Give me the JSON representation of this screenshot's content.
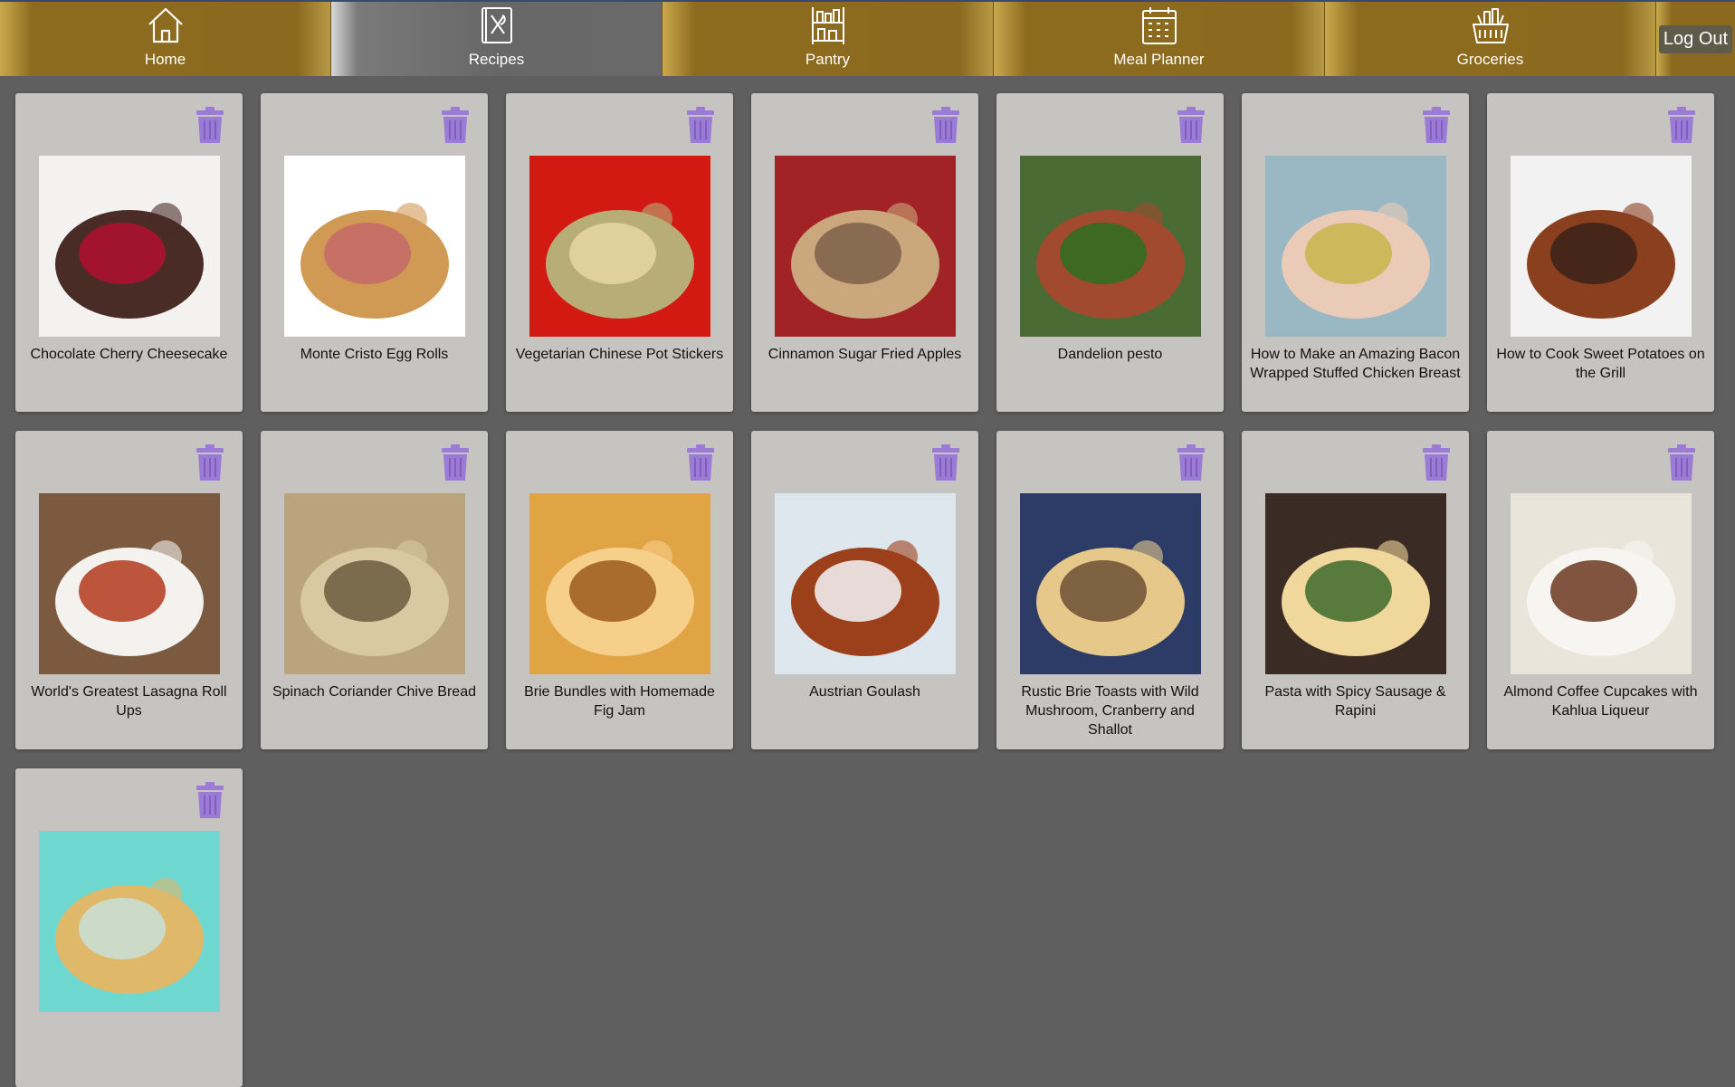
{
  "nav": {
    "items": [
      {
        "label": "Home",
        "icon": "home-icon"
      },
      {
        "label": "Recipes",
        "icon": "recipe-book-icon"
      },
      {
        "label": "Pantry",
        "icon": "pantry-shelf-icon"
      },
      {
        "label": "Meal Planner",
        "icon": "calendar-icon"
      },
      {
        "label": "Groceries",
        "icon": "grocery-basket-icon"
      }
    ],
    "active": "Recipes",
    "logout_label": "Log Out"
  },
  "recipes": [
    {
      "title": "Chocolate Cherry Cheesecake",
      "palette": [
        "#f4f2f0",
        "#4a2c26",
        "#b11030"
      ]
    },
    {
      "title": "Monte Cristo Egg Rolls",
      "palette": [
        "#ffffff",
        "#d09a55",
        "#c66a6a"
      ]
    },
    {
      "title": "Vegetarian Chinese Pot Stickers",
      "palette": [
        "#d21a12",
        "#b8ad77",
        "#e6d6a0"
      ]
    },
    {
      "title": "Cinnamon Sugar Fried Apples",
      "palette": [
        "#a22325",
        "#caa77c",
        "#7d6049"
      ]
    },
    {
      "title": "Dandelion pesto",
      "palette": [
        "#4a6b33",
        "#a24a2f",
        "#2c6e20"
      ]
    },
    {
      "title": "How to Make an Amazing Bacon Wrapped Stuffed Chicken Breast",
      "palette": [
        "#9ab7c4",
        "#e9cbb8",
        "#c8b64a"
      ]
    },
    {
      "title": "How to Cook Sweet Potatoes on the Grill",
      "palette": [
        "#f2f2f2",
        "#8a3f1f",
        "#3a2217"
      ]
    },
    {
      "title": "World's Greatest Lasagna Roll Ups",
      "palette": [
        "#7b5a3f",
        "#f3f2ee",
        "#b13a1c"
      ]
    },
    {
      "title": "Spinach Coriander Chive Bread",
      "palette": [
        "#b9a47e",
        "#d8c9a3",
        "#6b5c40"
      ]
    },
    {
      "title": "Brie Bundles with Homemade Fig Jam",
      "palette": [
        "#e0a445",
        "#f6d08a",
        "#9c5a1c"
      ]
    },
    {
      "title": "Austrian Goulash",
      "palette": [
        "#dfe7ee",
        "#9c3f1b",
        "#f5f6f8"
      ]
    },
    {
      "title": "Rustic Brie Toasts with Wild Mushroom, Cranberry and Shallot",
      "palette": [
        "#2c3c66",
        "#e6c98a",
        "#6b5035"
      ]
    },
    {
      "title": "Pasta with Spicy Sausage & Rapini",
      "palette": [
        "#3a2c24",
        "#f0d79b",
        "#3d6a2b"
      ]
    },
    {
      "title": "Almond Coffee Cupcakes with Kahlua Liqueur",
      "palette": [
        "#e9e5db",
        "#f6f5f2",
        "#6b3720"
      ]
    },
    {
      "title": "",
      "palette": [
        "#6fd8d1",
        "#e0b86a",
        "#c8e0d8"
      ]
    }
  ]
}
